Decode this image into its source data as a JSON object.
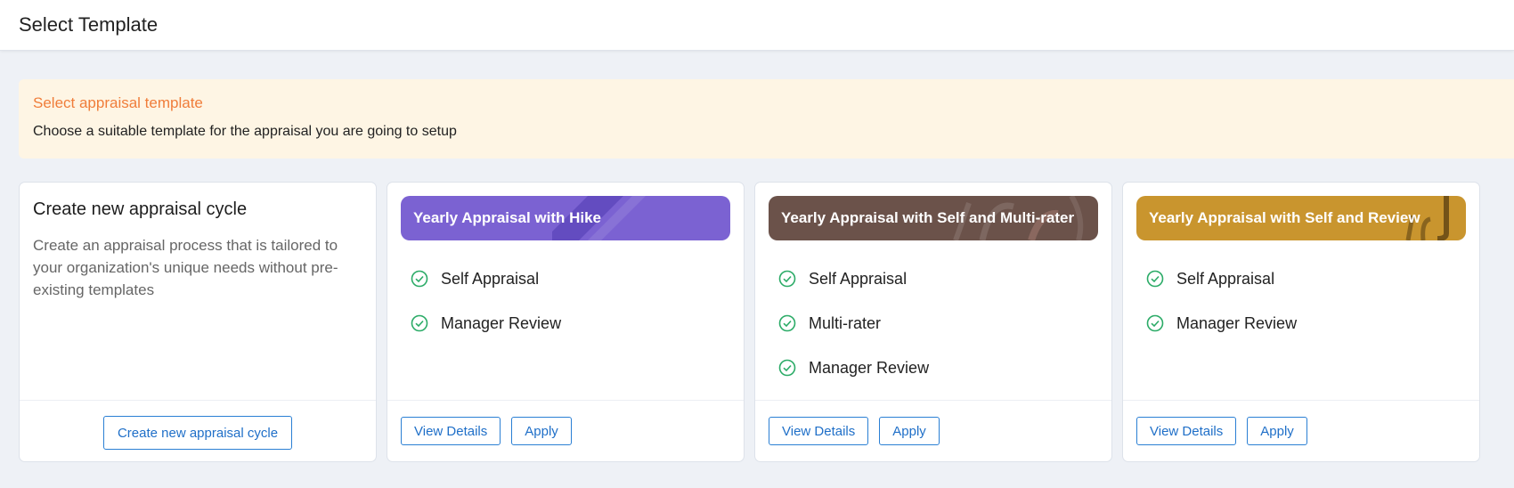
{
  "header": {
    "title": "Select Template"
  },
  "banner": {
    "title": "Select appraisal template",
    "description": "Choose a suitable template for the appraisal you are going to setup"
  },
  "create_card": {
    "title": "Create new appraisal cycle",
    "description": "Create an appraisal process that is tailored to your organization's unique needs without pre-existing templates",
    "button_label": "Create new appraisal cycle"
  },
  "templates": [
    {
      "title": "Yearly Appraisal with Hike",
      "color": "#7b62d2",
      "features": [
        "Self Appraisal",
        "Manager Review"
      ],
      "view_label": "View Details",
      "apply_label": "Apply"
    },
    {
      "title": "Yearly Appraisal with Self and Multi-rater",
      "color": "#6b524a",
      "features": [
        "Self Appraisal",
        "Multi-rater",
        "Manager Review"
      ],
      "view_label": "View Details",
      "apply_label": "Apply"
    },
    {
      "title": "Yearly Appraisal with Self and Review",
      "color": "#c9952e",
      "features": [
        "Self Appraisal",
        "Manager Review"
      ],
      "view_label": "View Details",
      "apply_label": "Apply"
    }
  ],
  "icons": {
    "feature": "check-circle-icon"
  },
  "colors": {
    "check": "#2bab67",
    "button": "#1f6fc8",
    "banner_title": "#f07d3a"
  }
}
